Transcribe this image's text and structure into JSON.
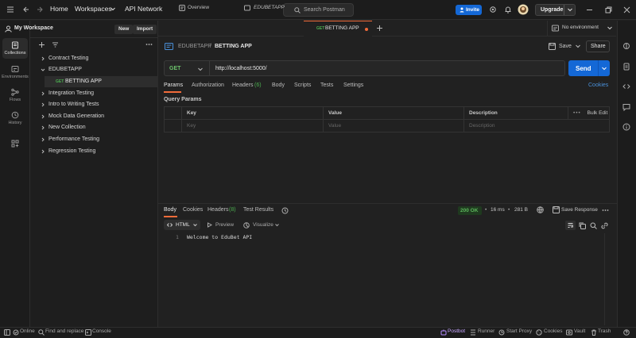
{
  "topbar": {
    "home": "Home",
    "workspaces": "Workspaces",
    "api_network": "API Network",
    "search_placeholder": "Search Postman",
    "invite": "Invite",
    "upgrade": "Upgrade"
  },
  "rail": {
    "collections": "Collections",
    "environments": "Environments",
    "flows": "Flows",
    "history": "History"
  },
  "sidebar": {
    "workspace_name": "My Workspace",
    "new_label": "New",
    "import_label": "Import",
    "tree": [
      {
        "label": "Contract Testing",
        "expanded": false
      },
      {
        "label": "EDUBETAPP",
        "expanded": true
      },
      {
        "label": "BETTING APP",
        "method": "GET",
        "child": true
      },
      {
        "label": "Integration Testing",
        "expanded": false
      },
      {
        "label": "Intro to Writing Tests",
        "expanded": false
      },
      {
        "label": "Mock Data Generation",
        "expanded": false
      },
      {
        "label": "New Collection",
        "expanded": false
      },
      {
        "label": "Performance Testing",
        "expanded": false
      },
      {
        "label": "Regression Testing",
        "expanded": false
      }
    ]
  },
  "tabs": {
    "items": [
      {
        "label": "Overview"
      },
      {
        "label": "EDUBETAPP"
      },
      {
        "method": "GET",
        "label": "BETTING APP"
      }
    ],
    "environment": "No environment"
  },
  "request": {
    "breadcrumb_parent": "EDUBETAPP",
    "breadcrumb_sep": "/",
    "breadcrumb_name": "BETTING APP",
    "save_label": "Save",
    "share_label": "Share",
    "method": "GET",
    "url": "http://localhost:5000/",
    "send_label": "Send",
    "tabs": [
      "Params",
      "Authorization",
      "Headers",
      "Body",
      "Scripts",
      "Tests",
      "Settings"
    ],
    "headers_count": "(6)",
    "cookies": "Cookies",
    "query_params_title": "Query Params",
    "table_headers": {
      "key": "Key",
      "value": "Value",
      "description": "Description",
      "bulk_edit": "Bulk Edit"
    },
    "table_placeholders": {
      "key": "Key",
      "value": "Value",
      "description": "Description"
    }
  },
  "response": {
    "tabs": {
      "body": "Body",
      "cookies": "Cookies",
      "headers": "Headers",
      "headers_count": "(8)",
      "test_results": "Test Results"
    },
    "status": "200 OK",
    "time": "16 ms",
    "size": "281 B",
    "save_response": "Save Response",
    "format": "HTML",
    "preview": "Preview",
    "visualize": "Visualize",
    "line_number": "1",
    "body_text": "Welcome to EduBet API"
  },
  "statusbar": {
    "online": "Online",
    "find_replace": "Find and replace",
    "console": "Console",
    "postbot": "Postbot",
    "runner": "Runner",
    "start_proxy": "Start Proxy",
    "cookies": "Cookies",
    "vault": "Vault",
    "trash": "Trash"
  },
  "colors": {
    "accent": "#1468d6",
    "get_method": "#4caf50",
    "tab_active_underline": "#f26b3a",
    "status_ok": "#5cb85c"
  }
}
